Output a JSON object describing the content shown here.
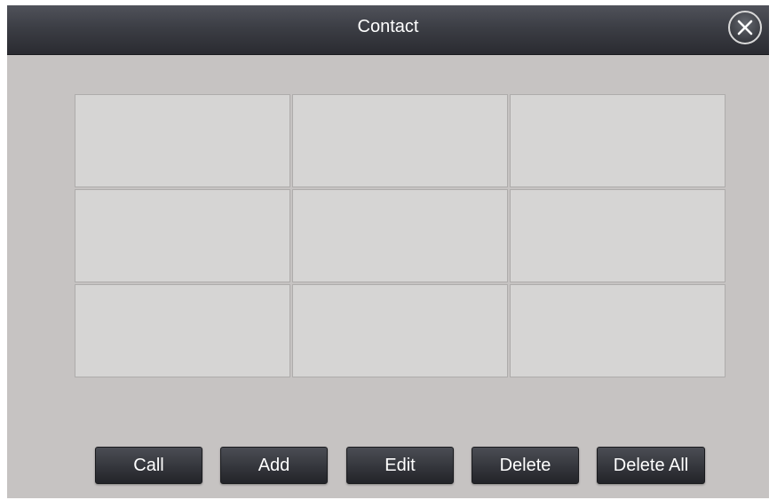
{
  "window": {
    "title": "Contact",
    "close_icon": "close-icon"
  },
  "contacts": {
    "slots": [
      "",
      "",
      "",
      "",
      "",
      "",
      "",
      "",
      ""
    ]
  },
  "actions": {
    "call_label": "Call",
    "add_label": "Add",
    "edit_label": "Edit",
    "delete_label": "Delete",
    "delete_all_label": "Delete All"
  },
  "colors": {
    "titlebar": "#3c3e45",
    "background": "#c6c3c2",
    "slot": "#d6d5d4",
    "button": "#34363c",
    "text_on_dark": "#ffffff"
  }
}
